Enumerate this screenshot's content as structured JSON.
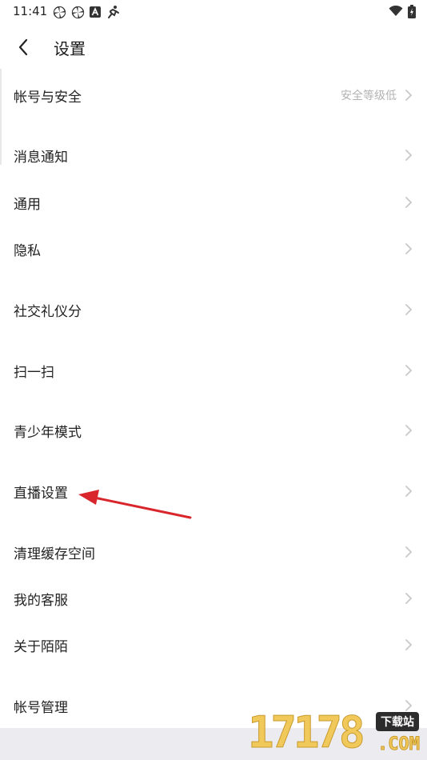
{
  "status_bar": {
    "time": "11:41",
    "left_icons": [
      "pinwheel-icon",
      "pinwheel-icon",
      "font-a-icon",
      "running-icon"
    ],
    "right_icons": [
      "wifi-icon",
      "battery-icon"
    ]
  },
  "header": {
    "title": "设置",
    "back_icon": "chevron-left-icon"
  },
  "settings_items": [
    {
      "id": "account-security",
      "label": "帐号与安全",
      "value": "安全等级低"
    },
    {
      "id": "notifications",
      "label": "消息通知",
      "value": ""
    },
    {
      "id": "general",
      "label": "通用",
      "value": ""
    },
    {
      "id": "privacy",
      "label": "隐私",
      "value": ""
    },
    {
      "id": "social-etiquette-score",
      "label": "社交礼仪分",
      "value": ""
    },
    {
      "id": "scan",
      "label": "扫一扫",
      "value": ""
    },
    {
      "id": "teen-mode",
      "label": "青少年模式",
      "value": ""
    },
    {
      "id": "live-settings",
      "label": "直播设置",
      "value": ""
    },
    {
      "id": "clear-cache",
      "label": "清理缓存空间",
      "value": ""
    },
    {
      "id": "customer-service",
      "label": "我的客服",
      "value": ""
    },
    {
      "id": "about",
      "label": "关于陌陌",
      "value": ""
    },
    {
      "id": "account-management",
      "label": "帐号管理",
      "value": ""
    }
  ],
  "annotation": {
    "arrow_color": "#d9262c"
  },
  "watermark": {
    "digits": "17178",
    "badge": "下载站",
    "suffix": ".COM"
  },
  "colors": {
    "text": "#222222",
    "secondary": "#b3b3b3",
    "chevron": "#c8c8c8",
    "background": "#ffffff"
  }
}
